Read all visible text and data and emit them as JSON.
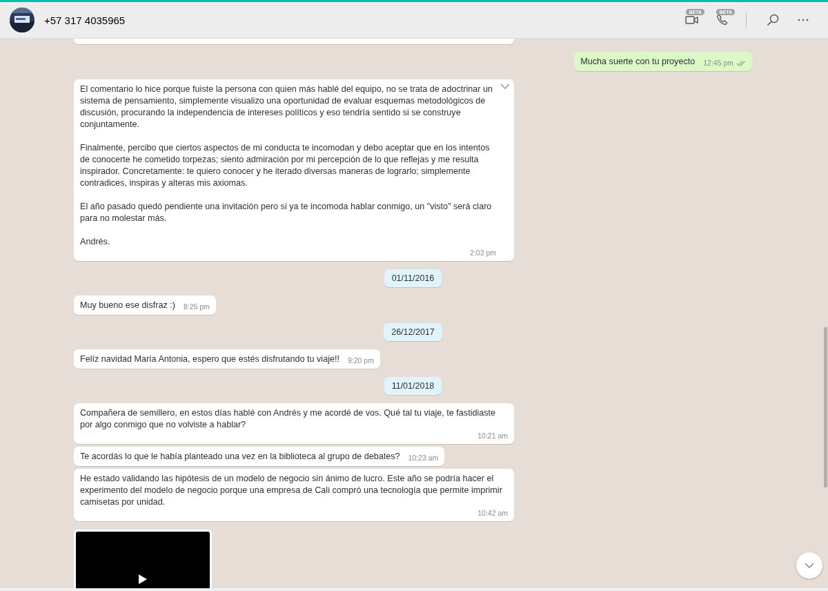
{
  "header": {
    "contact": "+57 317 4035965",
    "video_badge": "BETA",
    "call_badge": "BETA"
  },
  "messages": [
    {
      "kind": "partial"
    },
    {
      "kind": "out",
      "text": "Mucha suerte con tu proyecto",
      "time": "12:45 pm",
      "read": false
    },
    {
      "kind": "in",
      "text": "El comentario lo hice porque fuiste la persona con quien más hablé del equipo, no se trata de adoctrinar un sistema de pensamiento, simplemente visualizo una oportunidad de evaluar esquemas metodológicos de discusión, procurando la independencia de intereses políticos y eso tendría sentido si se construye conjuntamente.\n\nFinalmente, percibo que ciertos aspectos de mi conducta te incomodan y debo aceptar que en los intentos de conocerte he cometido torpezas; siento admiración por mi percepción de lo que reflejas y me resulta inspirador. Concretamente: te quiero conocer y he iterado diversas maneras de lograrlo; simplemente contradices, inspiras y alteras mis axiomas.\n\nEl año pasado quedó pendiente una invitación pero si ya te incomoda hablar conmigo, un \"visto\" será claro para no molestar más.\n\nAndrés.",
      "time": "2:03 pm",
      "menu_visible": true
    },
    {
      "kind": "date",
      "text": "01/11/2016"
    },
    {
      "kind": "in",
      "text": "Muy bueno ese disfraz :)",
      "time": "8:25 pm",
      "menu_visible": false
    },
    {
      "kind": "date",
      "text": "26/12/2017"
    },
    {
      "kind": "in",
      "text": "Felíz navidad María Antonia, espero que estés disfrutando tu viaje!!",
      "time": "9:20 pm",
      "menu_visible": false
    },
    {
      "kind": "date",
      "text": "11/01/2018"
    },
    {
      "kind": "in",
      "text": "Compañera de semillero, en estos días hablé con Andrés y me acordé de vos. Qué tal tu viaje, te fastidiaste por algo conmigo que no volviste a hablar?",
      "time": "10:21 am",
      "menu_visible": false
    },
    {
      "kind": "in",
      "text": "Te acordás lo que le había planteado una vez en la biblioteca al grupo de debates?",
      "time": "10:23 am",
      "menu_visible": false
    },
    {
      "kind": "in",
      "text": "He estado validando las hipótesis de un modelo de negocio sin ánimo de lucro. Este año se podría hacer el experimento del modelo de negocio porque una empresa de Cali compró una tecnología que permite imprimir camisetas por unidad.",
      "time": "10:42 am",
      "menu_visible": false
    },
    {
      "kind": "video"
    }
  ]
}
